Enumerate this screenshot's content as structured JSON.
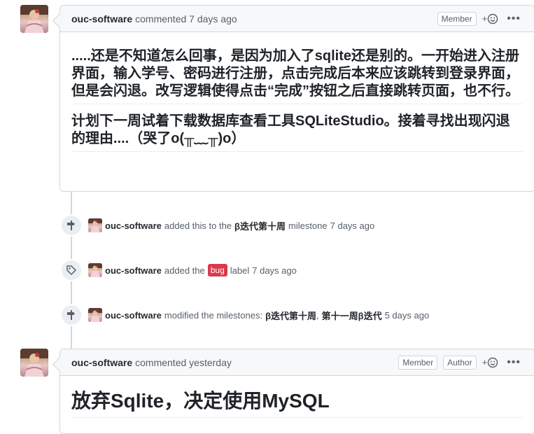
{
  "comment1": {
    "author": "ouc-software",
    "meta": "commented 7 days ago",
    "badge": "Member",
    "react": "+",
    "paragraphs": [
      ".....还是不知道怎么回事，是因为加入了sqlite还是别的。一开始进入注册界面，输入学号、密码进行注册，点击完成后本来应该跳转到登录界面，但是会闪退。改写逻辑使得点击“完成”按钮之后直接跳转页面，也不行。",
      "计划下一周试着下载数据库查看工具SQLiteStudio。接着寻找出现闪退的理由....（哭了o(╥﹏╥)o）"
    ]
  },
  "events": [
    {
      "actor": "ouc-software",
      "pre": "added this to the",
      "strong": "β迭代第十周",
      "post": "milestone",
      "time": "7 days ago",
      "icon": "milestone-icon"
    },
    {
      "actor": "ouc-software",
      "pre": "added the",
      "label": "bug",
      "post": "label",
      "time": "7 days ago",
      "icon": "tag-icon"
    },
    {
      "actor": "ouc-software",
      "pre": "modified the milestones:",
      "strong": "β迭代第十周",
      "sep": ",",
      "strong2": "第十一周β迭代",
      "time": "5 days ago",
      "icon": "milestone-icon"
    }
  ],
  "comment2": {
    "author": "ouc-software",
    "meta": "commented yesterday",
    "badge": "Member",
    "badge2": "Author",
    "react": "+",
    "heading": "放弃Sqlite，决定使用MySQL"
  },
  "colors": {
    "label_bug": "#d73a4a",
    "border": "#d0d7de",
    "header_bg": "#f6f8fa"
  }
}
